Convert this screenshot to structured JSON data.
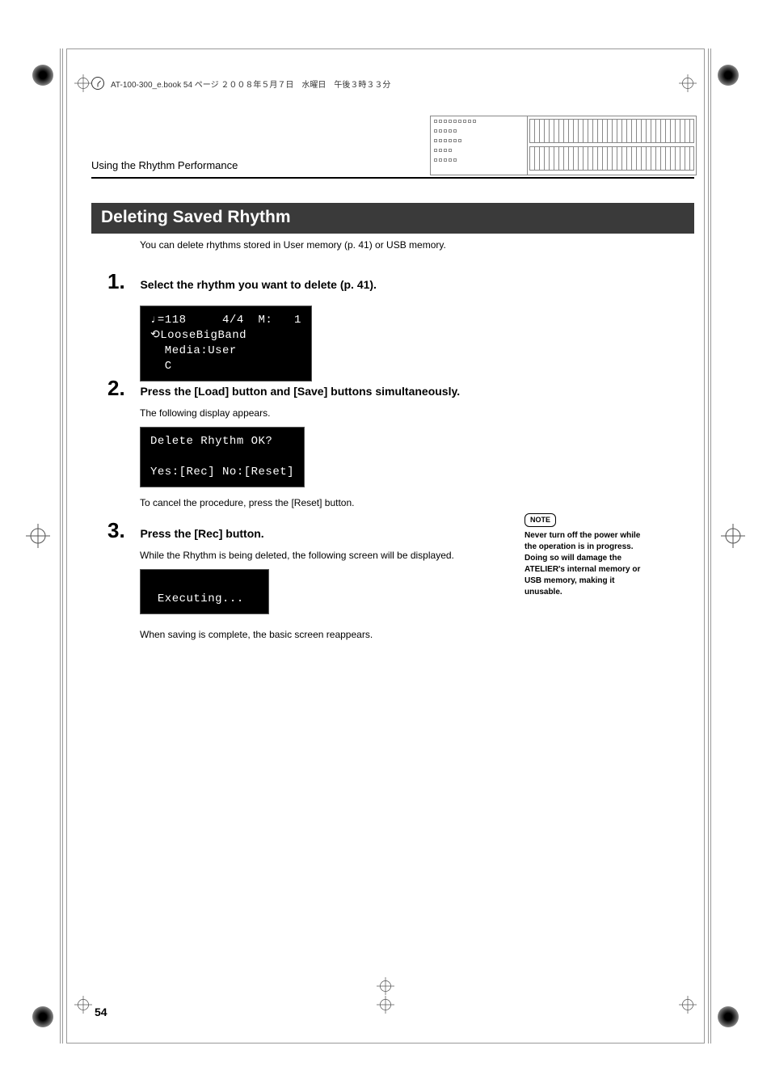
{
  "book_header": "AT-100-300_e.book  54 ページ  ２００８年５月７日　水曜日　午後３時３３分",
  "section_label": "Using the Rhythm Performance",
  "title": "Deleting Saved Rhythm",
  "intro": "You can delete rhythms stored in User memory (p. 41) or USB memory.",
  "steps": {
    "s1": {
      "num": "1.",
      "title": "Select the rhythm you want to delete (p. 41).",
      "lcd": "♩=118     4/4  M:   1\n⟲LooseBigBand\n  Media:User\n  C"
    },
    "s2": {
      "num": "2.",
      "title": "Press the [Load] button and [Save] buttons simultaneously.",
      "body1": "The following display appears.",
      "lcd": "Delete Rhythm OK?\n\nYes:[Rec] No:[Reset]",
      "body2": "To cancel the procedure, press the [Reset] button."
    },
    "s3": {
      "num": "3.",
      "title": "Press the [Rec] button.",
      "body1": "While the Rhythm is being deleted, the following screen will be displayed.",
      "lcd": "\n Executing...\n",
      "body2": "When saving is complete, the basic screen reappears."
    }
  },
  "note": {
    "badge": "NOTE",
    "text": "Never turn off the power while the operation is in progress. Doing so will damage the ATELIER's internal memory or USB memory, making it unusable."
  },
  "page_number": "54"
}
